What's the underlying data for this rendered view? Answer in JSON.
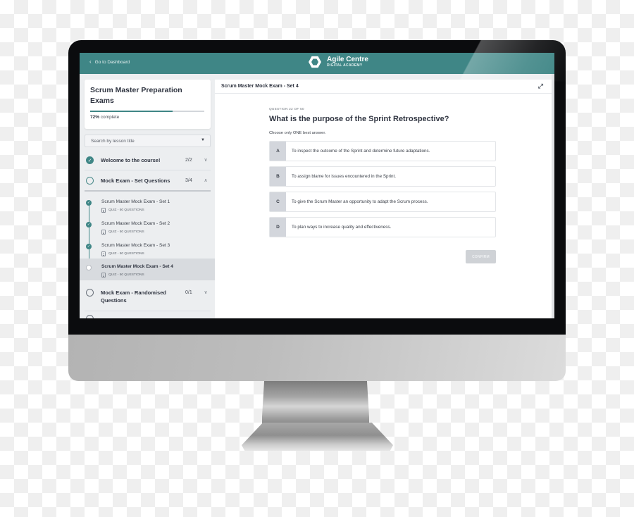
{
  "header": {
    "back_label": "Go to Dashboard",
    "brand_name": "Agile Centre",
    "brand_sub": "DIGITAL ACADEMY",
    "accent_color": "#3f8686"
  },
  "sidebar": {
    "course_title": "Scrum Master Preparation Exams",
    "progress_percent": 72,
    "progress_value": "72%",
    "progress_suffix": "complete",
    "search_placeholder": "Search by lesson title",
    "sections": [
      {
        "title": "Welcome to the course!",
        "count": "2/2",
        "status": "complete",
        "expanded": false
      },
      {
        "title": "Mock Exam - Set Questions",
        "count": "3/4",
        "status": "in-progress",
        "expanded": true,
        "lessons": [
          {
            "title": "Scrum Master Mock Exam - Set 1",
            "meta": "QUIZ - 50 QUESTIONS",
            "completed": true,
            "active": false
          },
          {
            "title": "Scrum Master Mock Exam - Set 2",
            "meta": "QUIZ - 50 QUESTIONS",
            "completed": true,
            "active": false
          },
          {
            "title": "Scrum Master Mock Exam - Set 3",
            "meta": "QUIZ - 50 QUESTIONS",
            "completed": true,
            "active": false
          },
          {
            "title": "Scrum Master Mock Exam - Set 4",
            "meta": "QUIZ - 50 QUESTIONS",
            "completed": false,
            "active": true
          }
        ]
      },
      {
        "title": "Mock Exam - Randomised Questions",
        "count": "0/1",
        "status": "not-started",
        "expanded": false
      }
    ]
  },
  "main": {
    "lesson_title": "Scrum Master Mock Exam - Set 4",
    "question_number": "QUESTION 22 OF 50",
    "question_text": "What is the purpose of the Sprint Retrospective?",
    "instruction": "Choose only ONE best answer.",
    "options": [
      {
        "letter": "A",
        "text": "To inspect the outcome of the Sprint and determine future adaptations."
      },
      {
        "letter": "B",
        "text": "To assign blame for issues encountered in the Sprint."
      },
      {
        "letter": "C",
        "text": "To give the Scrum Master an opportunity to adapt the Scrum process."
      },
      {
        "letter": "D",
        "text": "To plan ways to increase quality and effectiveness."
      }
    ],
    "confirm_label": "CONFIRM"
  },
  "icons": {
    "back": "‹",
    "expand": "⤢",
    "check": "✓",
    "chevron_down": "⌄",
    "chevron_up": "⌃",
    "caret_down": "▼"
  }
}
